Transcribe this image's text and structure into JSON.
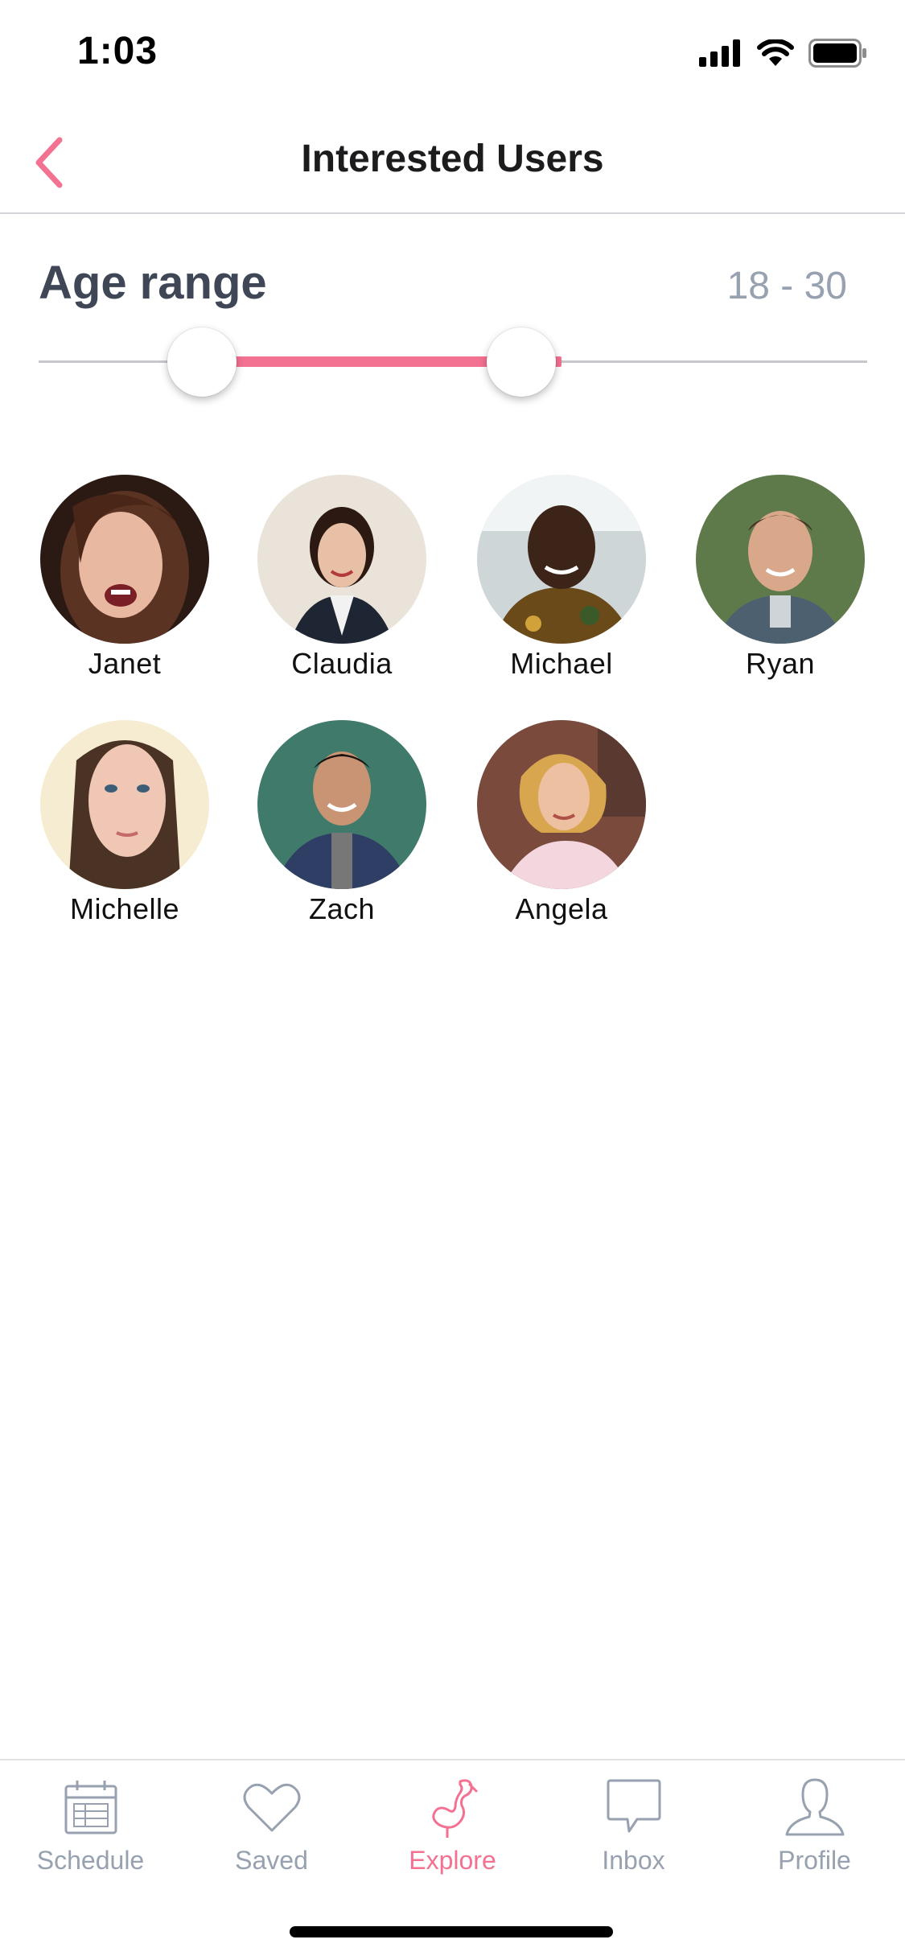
{
  "status": {
    "time": "1:03"
  },
  "nav": {
    "title": "Interested Users",
    "back_icon": "chevron-left-icon"
  },
  "filter": {
    "label": "Age range",
    "min": 18,
    "max": 30,
    "value_text": "18 - 30",
    "accent_color": "#f37191"
  },
  "users": [
    {
      "name": "Janet"
    },
    {
      "name": "Claudia"
    },
    {
      "name": "Michael"
    },
    {
      "name": "Ryan"
    },
    {
      "name": "Michelle"
    },
    {
      "name": "Zach"
    },
    {
      "name": "Angela"
    }
  ],
  "tabs": [
    {
      "label": "Schedule",
      "icon": "calendar-icon",
      "active": false
    },
    {
      "label": "Saved",
      "icon": "heart-icon",
      "active": false
    },
    {
      "label": "Explore",
      "icon": "flamingo-icon",
      "active": true
    },
    {
      "label": "Inbox",
      "icon": "chat-bubble-icon",
      "active": false
    },
    {
      "label": "Profile",
      "icon": "person-icon",
      "active": false
    }
  ],
  "colors": {
    "accent": "#f37191",
    "muted": "#97a1b0",
    "heading": "#3f4757"
  }
}
